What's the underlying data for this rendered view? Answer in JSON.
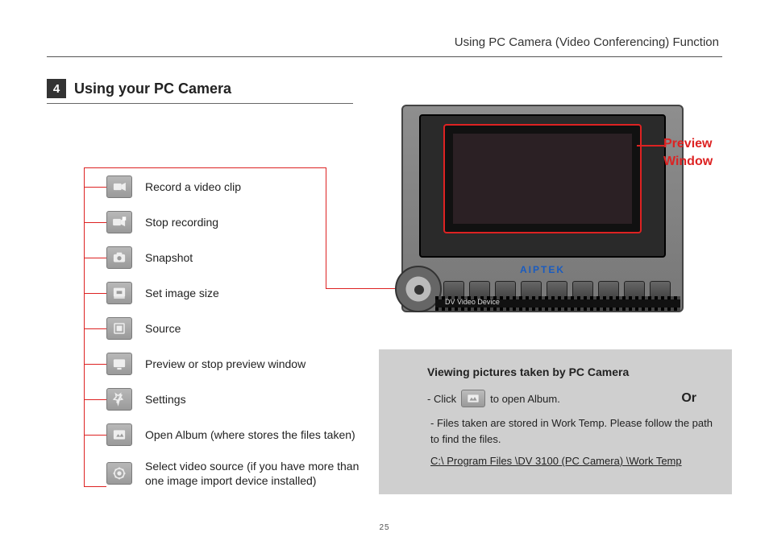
{
  "header": {
    "breadcrumb": "Using PC Camera (Video Conferencing) Function"
  },
  "section": {
    "number": "4",
    "title": "Using your PC Camera"
  },
  "icons": [
    {
      "name": "record-icon",
      "label": "Record a video clip"
    },
    {
      "name": "stop-icon",
      "label": "Stop recording"
    },
    {
      "name": "snapshot-icon",
      "label": "Snapshot"
    },
    {
      "name": "image-size-icon",
      "label": "Set image size"
    },
    {
      "name": "source-icon",
      "label": "Source"
    },
    {
      "name": "preview-icon",
      "label": "Preview or stop preview window"
    },
    {
      "name": "settings-icon",
      "label": "Settings"
    },
    {
      "name": "album-icon",
      "label": "Open Album (where stores the files taken)"
    },
    {
      "name": "select-source-icon",
      "label": "Select video source (if you have more than one image import device installed)"
    }
  ],
  "monitor": {
    "brand": "AIPTEK",
    "film_label": "DV Video Device",
    "callout_line1": "Preview",
    "callout_line2": "Window"
  },
  "infobox": {
    "title": "Viewing pictures taken by PC Camera",
    "click_prefix": "- Click",
    "click_suffix": "to open Album.",
    "or_text": "Or",
    "stored_text": "- Files taken are stored in Work Temp. Please follow the path to find the files.",
    "path": "C:\\ Program Files \\DV 3100 (PC Camera) \\Work Temp"
  },
  "page_number": "25"
}
